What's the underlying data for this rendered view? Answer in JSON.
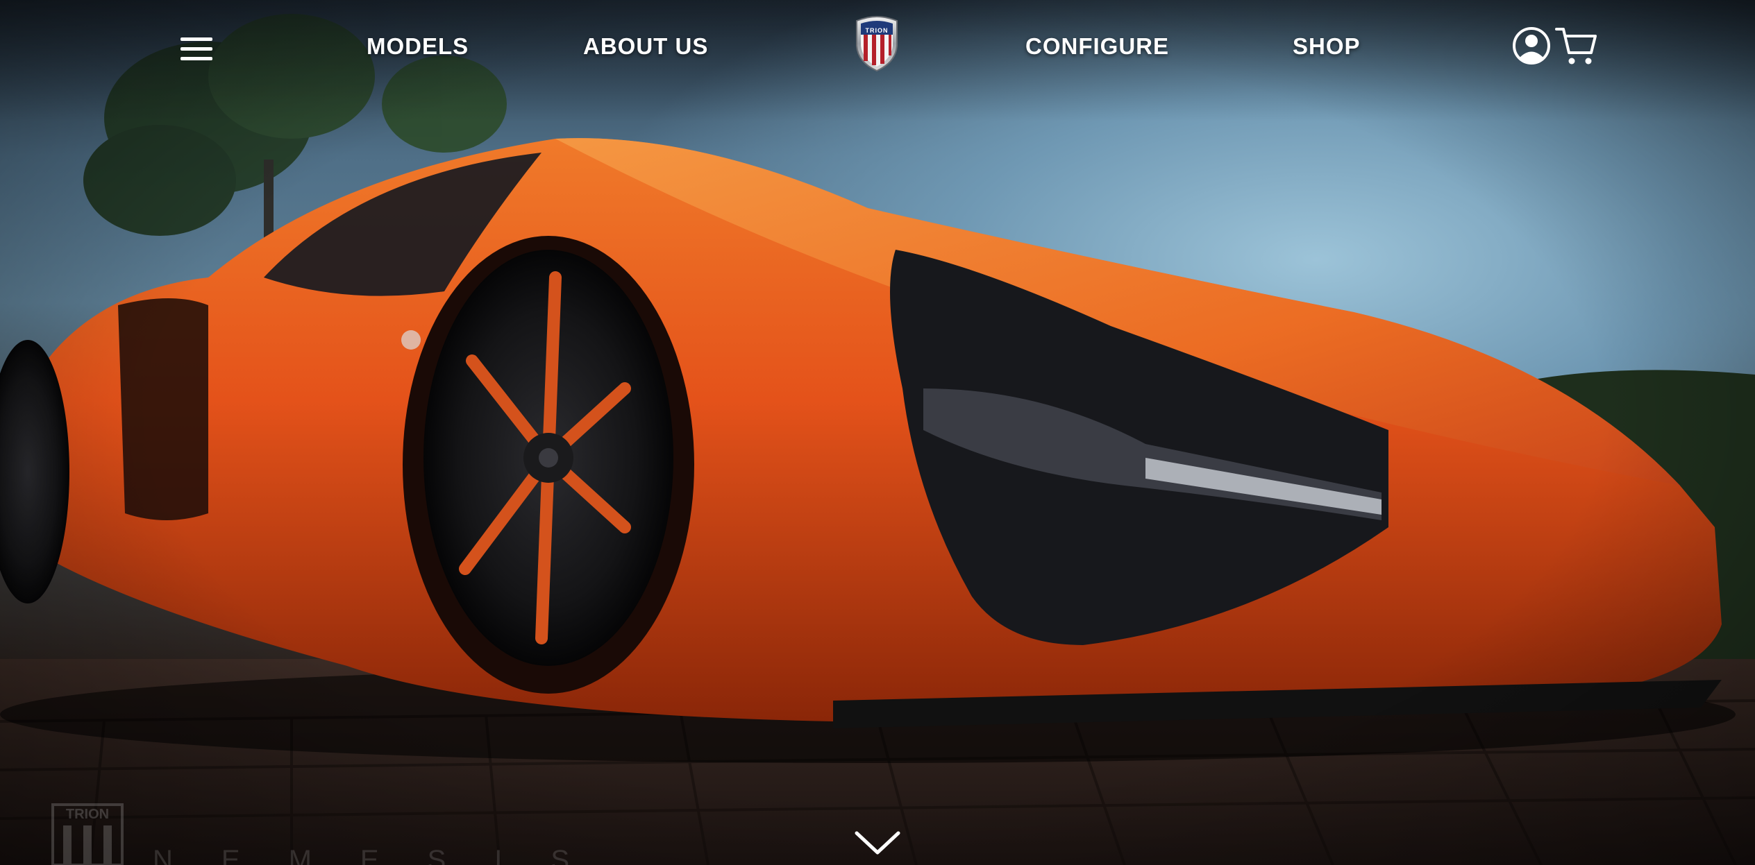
{
  "nav": {
    "menu_icon": "hamburger-menu-icon",
    "links": [
      {
        "label": "MODELS"
      },
      {
        "label": "ABOUT US"
      },
      {
        "label": "CONFIGURE"
      },
      {
        "label": "SHOP"
      }
    ],
    "logo_text": "TRION",
    "account_icon": "user-circle-icon",
    "cart_icon": "shopping-cart-icon"
  },
  "hero": {
    "image": "orange supercar",
    "scroll_icon": "chevron-down-icon",
    "watermark_logo_text": "TRION",
    "watermark_text": "NEMESIS"
  },
  "colors": {
    "nav_text": "#ffffff",
    "car_accent": "#e8541a",
    "logo_red": "#b4202a",
    "logo_blue": "#1f3a7a"
  }
}
